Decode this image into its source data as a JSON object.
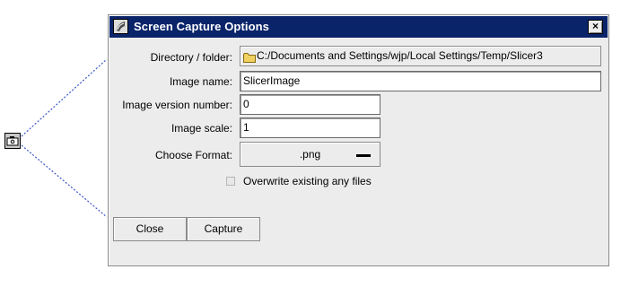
{
  "dialog": {
    "title": "Screen Capture Options",
    "close_glyph": "×"
  },
  "form": {
    "directory_label": "Directory / folder:",
    "directory_value": "C:/Documents and Settings/wjp/Local Settings/Temp/Slicer3",
    "image_name_label": "Image name:",
    "image_name_value": "SlicerImage",
    "version_label": "Image version number:",
    "version_value": "0",
    "scale_label": "Image scale:",
    "scale_value": "1",
    "format_label": "Choose Format:",
    "format_value": ".png",
    "overwrite_label": "Overwrite existing any files",
    "overwrite_checked": false
  },
  "buttons": {
    "close_label": "Close",
    "capture_label": "Capture"
  },
  "icons": {
    "launcher": "camera-icon",
    "title": "slicer-app-icon",
    "folder": "folder-icon",
    "window_close": "close-icon"
  },
  "colors": {
    "titlebar": "#0a246a",
    "callout_line": "#3a55c8",
    "folder": "#f0d060"
  }
}
